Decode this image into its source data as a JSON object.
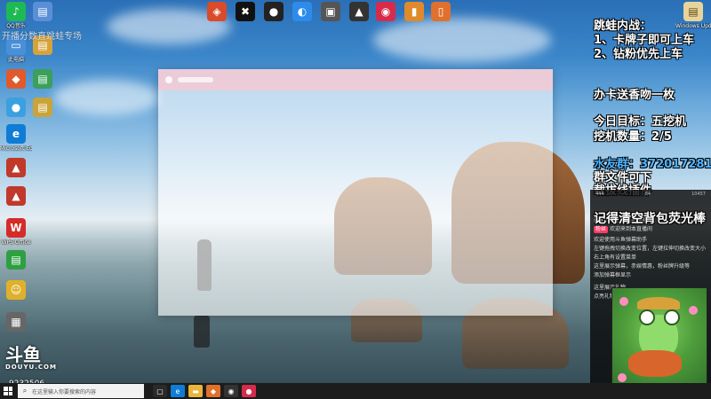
{
  "desktop_icons_left": [
    {
      "label": "QQ音乐",
      "color": "#1db954",
      "glyph": "♪"
    },
    {
      "label": "此电脑",
      "color": "#4a90d9",
      "glyph": "▭"
    },
    {
      "label": "",
      "color": "#e05a2b",
      "glyph": "◆"
    },
    {
      "label": "",
      "color": "#3aa0e0",
      "glyph": "●"
    },
    {
      "label": "Microsoft Edge",
      "color": "#0f7dd6",
      "glyph": "e"
    },
    {
      "label": "",
      "color": "#c0392b",
      "glyph": "▲"
    },
    {
      "label": "",
      "color": "#c0392b",
      "glyph": "▲"
    },
    {
      "label": "WPS Office",
      "color": "#d62b2b",
      "glyph": "W"
    },
    {
      "label": "",
      "color": "#2ea043",
      "glyph": "▤"
    },
    {
      "label": "",
      "color": "#e0b02b",
      "glyph": "☺"
    },
    {
      "label": "",
      "color": "#666666",
      "glyph": "▦"
    }
  ],
  "desktop_icons_top": [
    {
      "label": "",
      "color": "#d94b2b",
      "glyph": "◈"
    },
    {
      "label": "",
      "color": "#111111",
      "glyph": "✖"
    },
    {
      "label": "",
      "color": "#222222",
      "glyph": "●"
    },
    {
      "label": "",
      "color": "#2d8ceb",
      "glyph": "◐"
    },
    {
      "label": "",
      "color": "#555555",
      "glyph": "▣"
    },
    {
      "label": "",
      "color": "#333333",
      "glyph": "▲"
    },
    {
      "label": "",
      "color": "#d62b4b",
      "glyph": "◉"
    },
    {
      "label": "",
      "color": "#e08a2b",
      "glyph": "▮"
    },
    {
      "label": "",
      "color": "#e0702b",
      "glyph": "▯"
    }
  ],
  "desktop_icon_right": {
    "label": "Windows Update B...",
    "color": "#e8d39a",
    "glyph": "▤"
  },
  "ghost_text": [
    "开播分数直跳蛙专场",
    "",
    "",
    "",
    "",
    "",
    "",
    ""
  ],
  "overlay": {
    "title1": "跳蛙内战：",
    "rule1": "1、卡牌子即可上车",
    "rule2": "2、钻粉优先上车",
    "gift": "办卡送香吻一枚",
    "goal_label": "今日目标：五挖机",
    "count_label": "挖机数量：2/5",
    "group": "水友群：372017281",
    "file_note": "群文件可下",
    "plugin_note": "载拔线插件",
    "backpack_note": "记得清空背包荧光棒"
  },
  "chat": {
    "stats": [
      "444",
      "84",
      "10457"
    ],
    "lines": [
      "这里展示水友进场消息",
      "欢迎来到本直播间",
      "",
      "欢迎使用斗鱼弹幕助手",
      "左键拖拽切换改变位置，左键拉伸切换改变大小",
      "右上角有设置菜单",
      "这里展示弹幕，赤娱情惠，粉丝牌升级等",
      "添加弹幕框显示",
      "",
      "",
      "这里展示礼物",
      "点亮礼物"
    ],
    "badge_text": "粉丝"
  },
  "douyu": {
    "logo": "斗鱼",
    "domain": "DOUYU.COM",
    "room": "9232506"
  },
  "taskbar": {
    "search_placeholder": "在这里输入你要搜索的内容",
    "apps": [
      {
        "name": "task-view",
        "color": "#2a2a2a",
        "glyph": "▢"
      },
      {
        "name": "edge",
        "color": "#0f7dd6",
        "glyph": "e"
      },
      {
        "name": "file-explorer",
        "color": "#e8b43a",
        "glyph": "▬"
      },
      {
        "name": "app-orange",
        "color": "#e0702b",
        "glyph": "◆"
      },
      {
        "name": "app-dark",
        "color": "#333333",
        "glyph": "◉"
      },
      {
        "name": "app-red",
        "color": "#d62b4b",
        "glyph": "●"
      }
    ]
  }
}
